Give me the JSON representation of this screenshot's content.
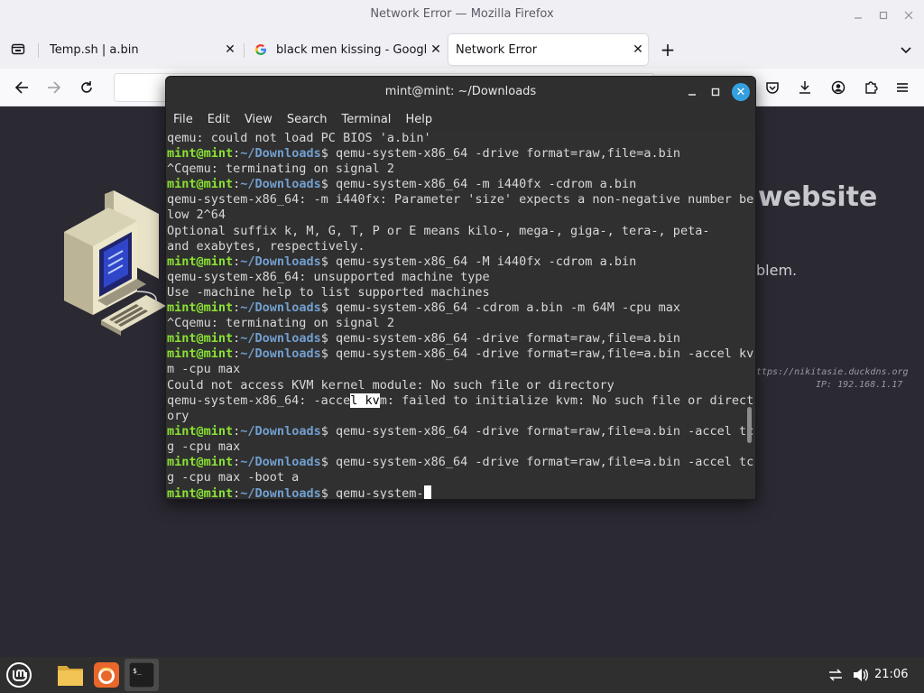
{
  "firefox": {
    "window_title": "Network Error — Mozilla Firefox",
    "tabs": [
      {
        "label": "Temp.sh | a.bin"
      },
      {
        "label": "black men kissing - Google S"
      },
      {
        "label": "Network Error"
      }
    ],
    "new_tab_label": "+",
    "error_page": {
      "heading": "website",
      "text": "blem.",
      "server_url": "ttps://nikitasie.duckdns.org",
      "server_ip": "IP: 192.168.1.17"
    }
  },
  "terminal": {
    "title": "mint@mint: ~/Downloads",
    "menu": [
      "File",
      "Edit",
      "View",
      "Search",
      "Terminal",
      "Help"
    ],
    "prompt": {
      "user": "mint@mint",
      "colon": ":",
      "path": "~/Downloads",
      "dollar": "$ "
    },
    "lines": [
      {
        "type": "out",
        "text": "qemu: could not load PC BIOS 'a.bin'"
      },
      {
        "type": "cmd",
        "text": "qemu-system-x86_64 -drive format=raw,file=a.bin"
      },
      {
        "type": "out",
        "text": "^Cqemu: terminating on signal 2"
      },
      {
        "type": "cmd",
        "text": "qemu-system-x86_64 -m i440fx -cdrom a.bin"
      },
      {
        "type": "out",
        "text": "qemu-system-x86_64: -m i440fx: Parameter 'size' expects a non-negative number be"
      },
      {
        "type": "out",
        "text": "low 2^64"
      },
      {
        "type": "out",
        "text": "Optional suffix k, M, G, T, P or E means kilo-, mega-, giga-, tera-, peta-"
      },
      {
        "type": "out",
        "text": "and exabytes, respectively."
      },
      {
        "type": "cmd",
        "text": "qemu-system-x86_64 -M i440fx -cdrom a.bin"
      },
      {
        "type": "out",
        "text": "qemu-system-x86_64: unsupported machine type"
      },
      {
        "type": "out",
        "text": "Use -machine help to list supported machines"
      },
      {
        "type": "cmd",
        "text": "qemu-system-x86_64 -cdrom a.bin -m 64M -cpu max"
      },
      {
        "type": "out",
        "text": "^Cqemu: terminating on signal 2"
      },
      {
        "type": "cmd",
        "text": "qemu-system-x86_64 -drive format=raw,file=a.bin"
      },
      {
        "type": "cmd",
        "text": "qemu-system-x86_64 -drive format=raw,file=a.bin -accel kv"
      },
      {
        "type": "out",
        "text": "m -cpu max"
      },
      {
        "type": "out",
        "text": "Could not access KVM kernel module: No such file or directory"
      },
      {
        "type": "sel",
        "before": "qemu-system-x86_64: -acce",
        "selected": "l kv",
        "after": "m: failed to initialize kvm: No such file or direct"
      },
      {
        "type": "out",
        "text": "ory"
      },
      {
        "type": "cmd",
        "text": "qemu-system-x86_64 -drive format=raw,file=a.bin -accel tc"
      },
      {
        "type": "out",
        "text": "g -cpu max"
      },
      {
        "type": "cmd",
        "text": "qemu-system-x86_64 -drive format=raw,file=a.bin -accel tc"
      },
      {
        "type": "out",
        "text": "g -cpu max -boot a"
      },
      {
        "type": "cur",
        "text": "qemu-system-"
      }
    ]
  },
  "taskbar": {
    "clock": "21:06",
    "apps": [
      "mint-menu-icon",
      "files-icon",
      "firefox-icon",
      "terminal-icon"
    ]
  },
  "colors": {
    "prompt_user": "#8ae234",
    "prompt_path": "#729fcf",
    "terminal_bg": "#303030",
    "page_bg": "#2b2a33"
  }
}
